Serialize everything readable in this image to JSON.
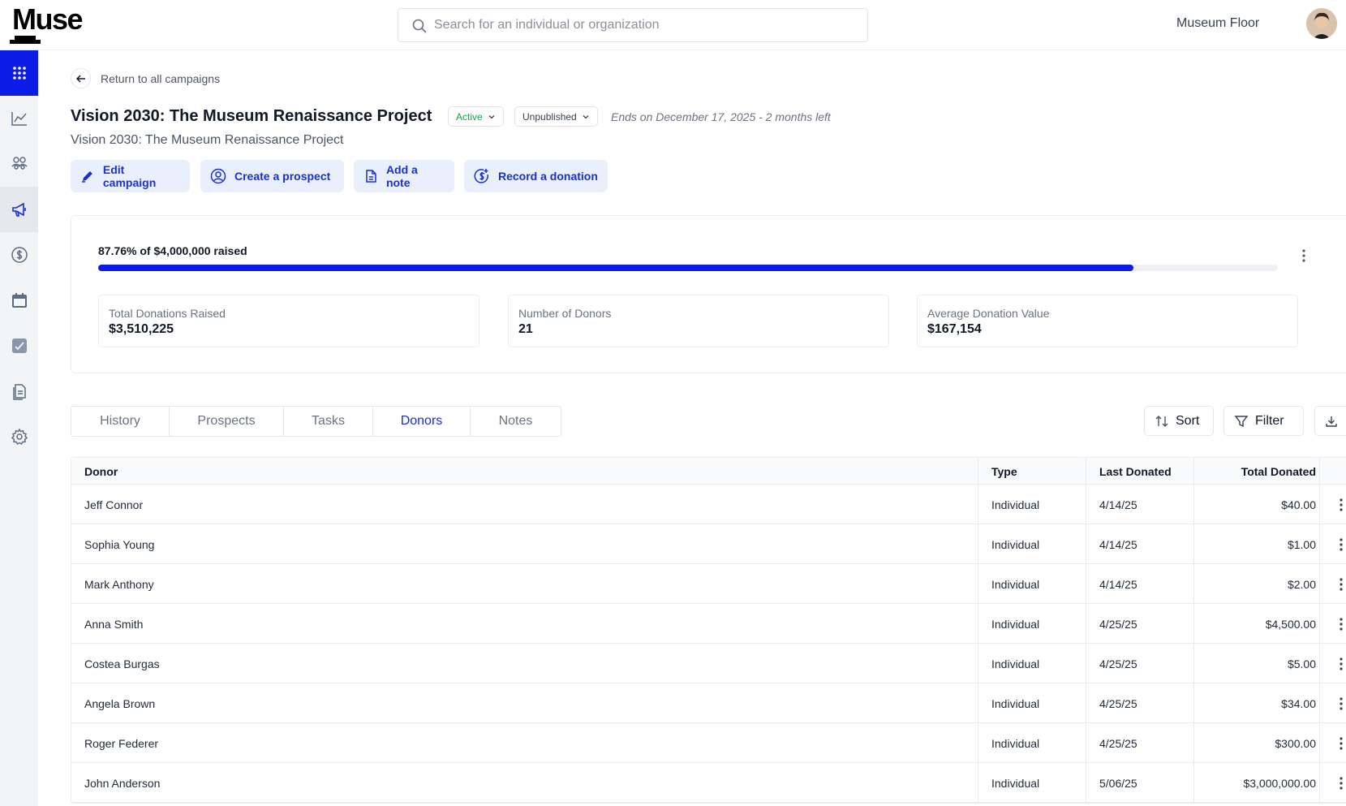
{
  "brand": {
    "logo": "Muse"
  },
  "search": {
    "placeholder": "Search for an individual or organization"
  },
  "header": {
    "org_name": "Museum Floor"
  },
  "sidebar": {
    "items": [
      {
        "icon": "apps-grid-icon"
      },
      {
        "icon": "chart-line-icon"
      },
      {
        "icon": "people-group-icon"
      },
      {
        "icon": "megaphone-icon"
      },
      {
        "icon": "dollar-circle-icon"
      },
      {
        "icon": "calendar-icon"
      },
      {
        "icon": "tasks-check-icon"
      },
      {
        "icon": "documents-icon"
      },
      {
        "icon": "gear-icon"
      }
    ]
  },
  "nav": {
    "back_label": "Return to all campaigns"
  },
  "campaign": {
    "title": "Vision 2030: The Museum Renaissance Project",
    "status": "Active",
    "publish_state": "Unpublished",
    "ends": "Ends on December 17, 2025 - 2 months left",
    "subtitle": "Vision 2030: The Museum Renaissance Project"
  },
  "actions": {
    "edit": "Edit campaign",
    "prospect": "Create a prospect",
    "note": "Add a note",
    "donation": "Record a donation"
  },
  "progress": {
    "label": "87.76% of $4,000,000 raised",
    "fraction": 0.8776,
    "color": "#0b1ce6"
  },
  "stats": {
    "total_label": "Total Donations Raised",
    "total_value": "$3,510,225",
    "donors_label": "Number of Donors",
    "donors_value": "21",
    "avg_label": "Average Donation Value",
    "avg_value": "$167,154"
  },
  "tabs": {
    "history": "History",
    "prospects": "Prospects",
    "tasks": "Tasks",
    "donors": "Donors",
    "notes": "Notes",
    "active": "Donors"
  },
  "toolbar": {
    "sort": "Sort",
    "filter": "Filter"
  },
  "table": {
    "columns": {
      "donor": "Donor",
      "type": "Type",
      "last": "Last Donated",
      "total": "Total Donated"
    },
    "rows": [
      {
        "donor": "Jeff Connor",
        "type": "Individual",
        "last": "4/14/25",
        "total": "$40.00"
      },
      {
        "donor": "Sophia Young",
        "type": "Individual",
        "last": "4/14/25",
        "total": "$1.00"
      },
      {
        "donor": "Mark Anthony",
        "type": "Individual",
        "last": "4/14/25",
        "total": "$2.00"
      },
      {
        "donor": "Anna Smith",
        "type": "Individual",
        "last": "4/25/25",
        "total": "$4,500.00"
      },
      {
        "donor": "Costea Burgas",
        "type": "Individual",
        "last": "4/25/25",
        "total": "$5.00"
      },
      {
        "donor": "Angela Brown",
        "type": "Individual",
        "last": "4/25/25",
        "total": "$34.00"
      },
      {
        "donor": "Roger Federer",
        "type": "Individual",
        "last": "4/25/25",
        "total": "$300.00"
      },
      {
        "donor": "John Anderson",
        "type": "Individual",
        "last": "5/06/25",
        "total": "$3,000,000.00"
      }
    ]
  },
  "colors": {
    "accent": "#0b1ce6",
    "action_bg": "#eaf0fb",
    "active_status": "#16a34a"
  }
}
